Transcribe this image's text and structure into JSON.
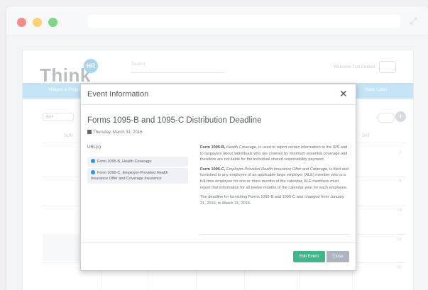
{
  "browser": {
    "url": "",
    "expand_icon": "expand-icon"
  },
  "app": {
    "logo_text": "Think",
    "logo_badge": "HR",
    "search_placeholder": "Search",
    "welcome_text": "Welcome Test Embed",
    "nav_left": "Villages & Programs",
    "nav_right": "Static Label",
    "calendar": {
      "view_select": "April",
      "days": {
        "sun": "SUN",
        "sat": "SAT"
      },
      "numbers": [
        "2",
        "9",
        "16",
        "23",
        "30"
      ]
    }
  },
  "modal": {
    "header_title": "Event Information",
    "close_symbol": "✕",
    "event_title": "Forms 1095-B and 1095-C Distribution Deadline",
    "event_date": "Thursday, March 31, 2016",
    "urls_label": "URL(s)",
    "urls": [
      "Form 1095-B, Health Coverage",
      "Form 1095-C, Employer-Provided Health Insurance Offer and Coverage Insurance"
    ],
    "description": [
      {
        "bold": "Form 1095-B,",
        "italic": " Health Coverage,",
        "rest": " is used to report certain information to the IRS and to taxpayers about individuals who are covered by minimum essential coverage and therefore are not liable for the individual shared responsibility payment."
      },
      {
        "bold": "Form 1095-C,",
        "italic": " Employer-Provided Health Insurance Offer and Coverage,",
        "rest": " is filed and furnished to any employee of an applicable large employer (ALE) member who is a full-time employee for one or more months of the calendar, ALE members must report that information for all twelve months of the calendar year for each employee."
      },
      {
        "bold": "",
        "italic": "",
        "rest": "The deadline for furnishing Forms 1095-B and 1095-C was changed from January 31, 2016, to March 31, 2016."
      }
    ],
    "buttons": {
      "edit": "Edit Event",
      "close": "Close"
    }
  }
}
